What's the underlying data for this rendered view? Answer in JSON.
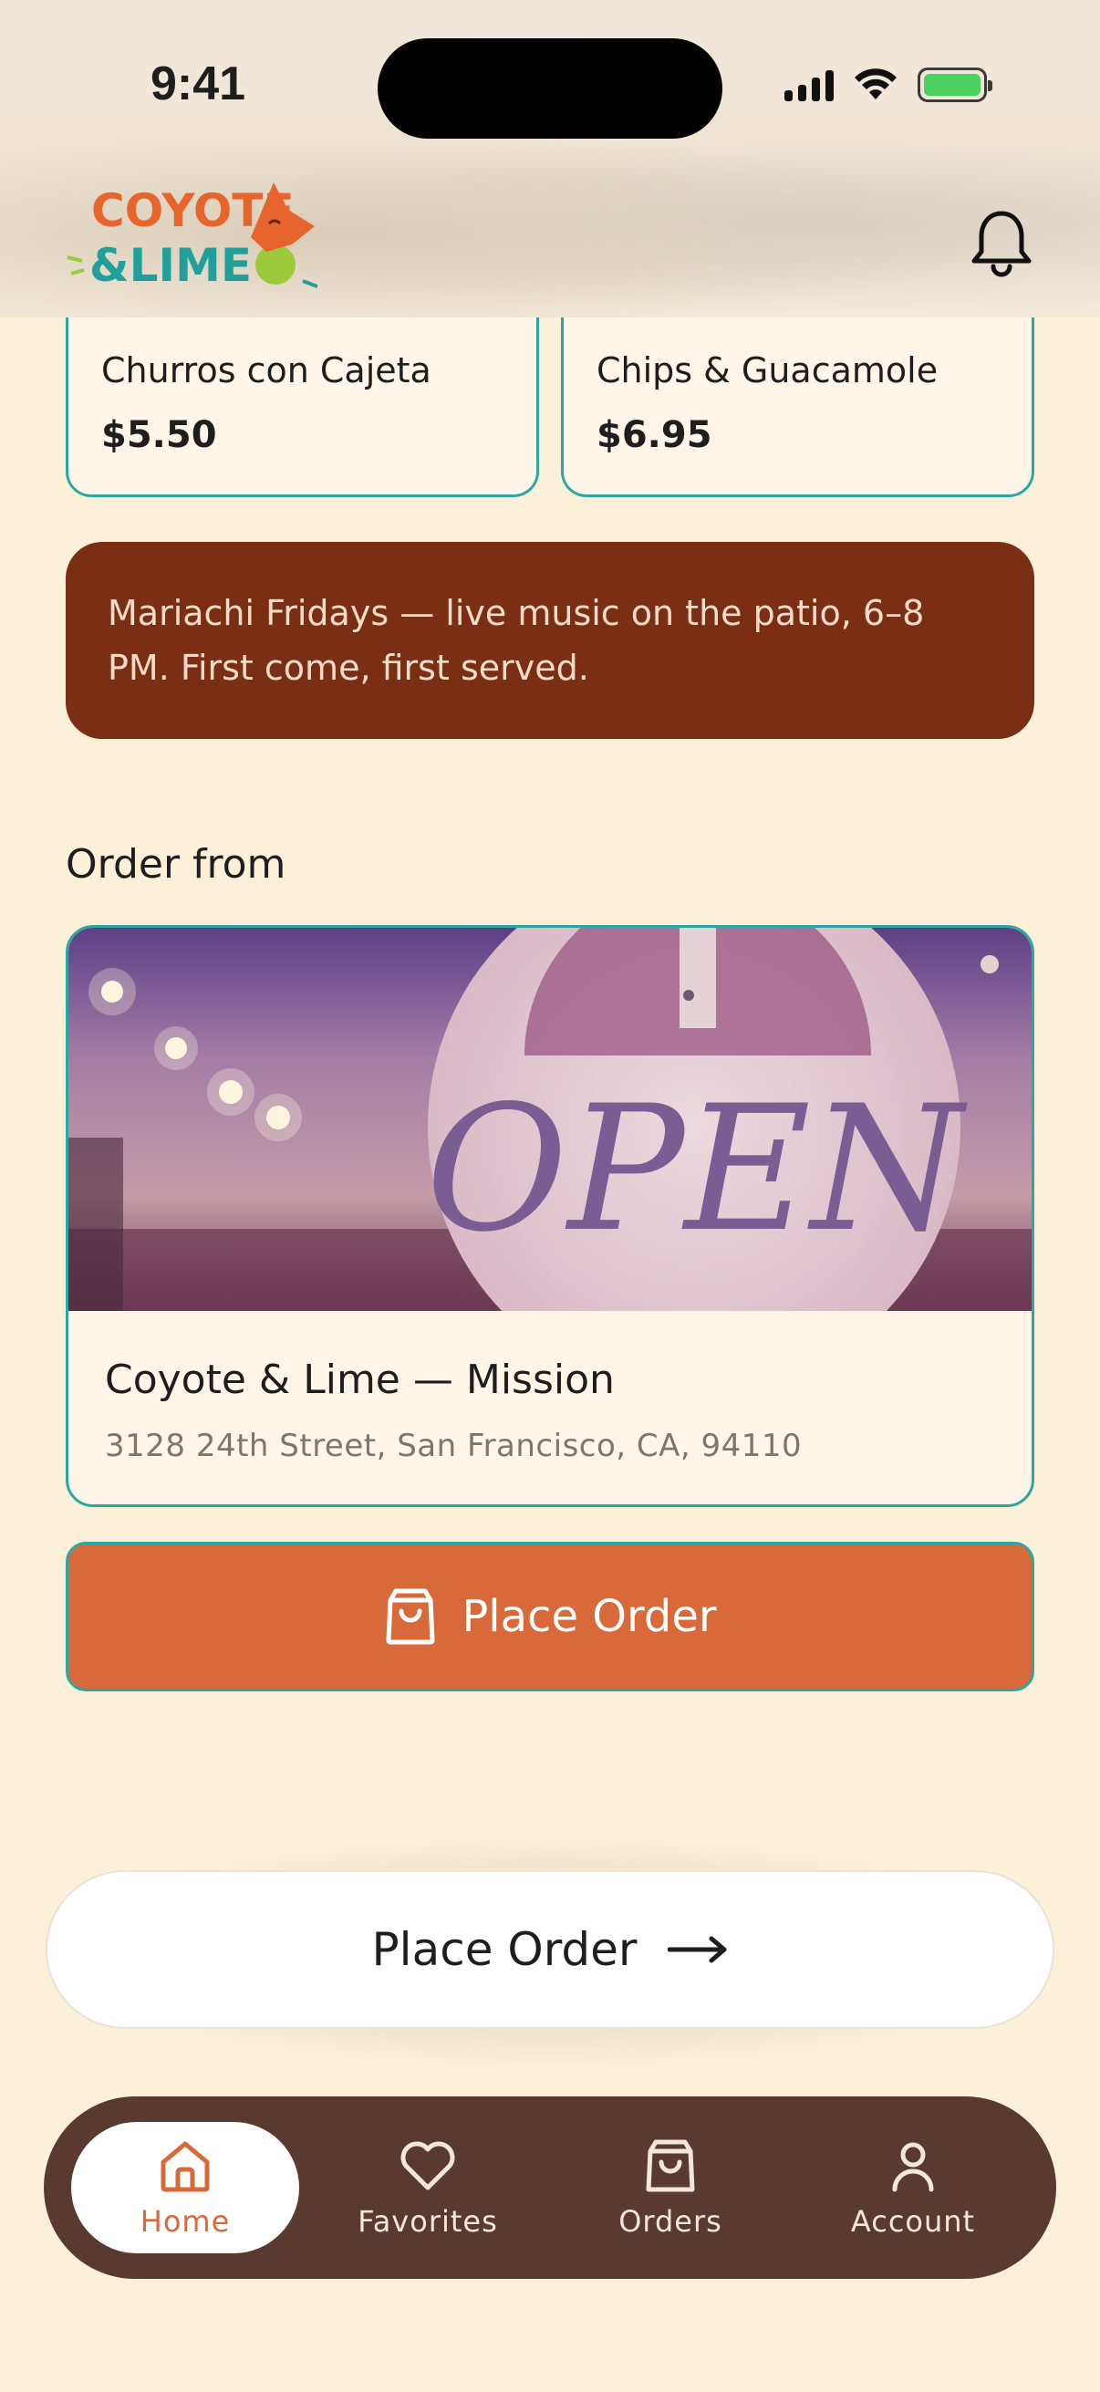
{
  "status_bar": {
    "time": "9:41"
  },
  "brand": {
    "line1": "COYOTE",
    "line2": "&LIME",
    "colors": {
      "orange": "#E8642D",
      "teal": "#21A09B",
      "lime": "#9BCB3B"
    }
  },
  "menu": {
    "items": [
      {
        "name": "Churros con Cajeta",
        "price": "$5.50"
      },
      {
        "name": "Chips & Guacamole",
        "price": "$6.95"
      }
    ]
  },
  "promo": {
    "text": "Mariachi Fridays — live music on the patio, 6–8 PM. First come, first served."
  },
  "order_from": {
    "title": "Order from",
    "photo_sign": "OPEN",
    "location_name": "Coyote & Lime — Mission",
    "address": "3128 24th Street, San Francisco, CA, 94110"
  },
  "actions": {
    "place_order": "Place Order",
    "cta_place_order": "Place Order"
  },
  "nav": {
    "items": [
      {
        "label": "Home",
        "icon": "home-icon",
        "active": true
      },
      {
        "label": "Favorites",
        "icon": "heart-icon",
        "active": false
      },
      {
        "label": "Orders",
        "icon": "bag-icon",
        "active": false
      },
      {
        "label": "Account",
        "icon": "user-icon",
        "active": false
      }
    ]
  },
  "colors": {
    "background": "#FDF0D9",
    "accent": "#D8693B",
    "border": "#2BA8A2",
    "promo": "#7A2E14",
    "nav": "#5A3A2E"
  }
}
